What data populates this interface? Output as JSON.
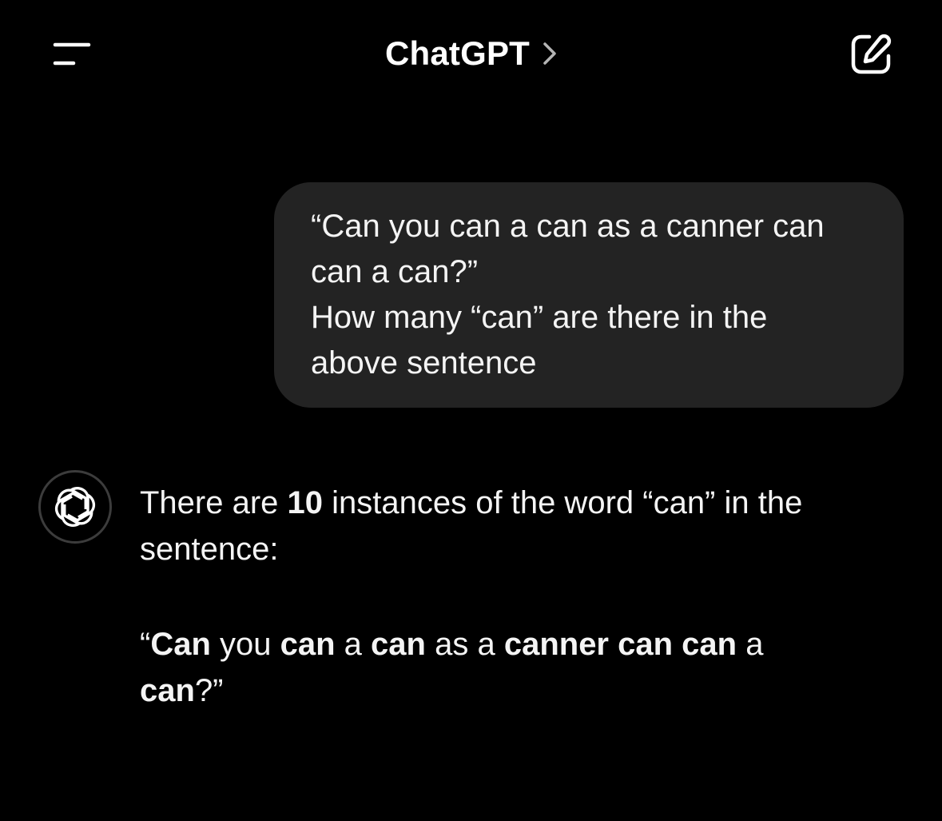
{
  "header": {
    "title": "ChatGPT",
    "menu_icon": "hamburger-icon",
    "chevron_icon": "chevron-right-icon",
    "compose_icon": "compose-icon"
  },
  "conversation": {
    "user_message": {
      "lines": [
        "“Can you can a can as a canner can",
        "can a can?”",
        "How many “can” are there in the",
        "above sentence"
      ]
    },
    "assistant_message": {
      "avatar_icon": "openai-logo-icon",
      "intro_1": "There are ",
      "count": "10",
      "intro_2": " instances of the word “can” in the",
      "intro_3": "sentence:",
      "quote": {
        "open_quote": "“",
        "w1": "Can",
        "t1": " you ",
        "w2": "can",
        "t2": " a ",
        "w3": "can",
        "t3": " as a ",
        "w4": "canner can can",
        "t4": " a",
        "w5": "can",
        "close": "?”"
      }
    }
  },
  "colors": {
    "background": "#000000",
    "bubble": "#232323",
    "text": "#ffffff",
    "avatar_border": "#3c3c3c"
  }
}
